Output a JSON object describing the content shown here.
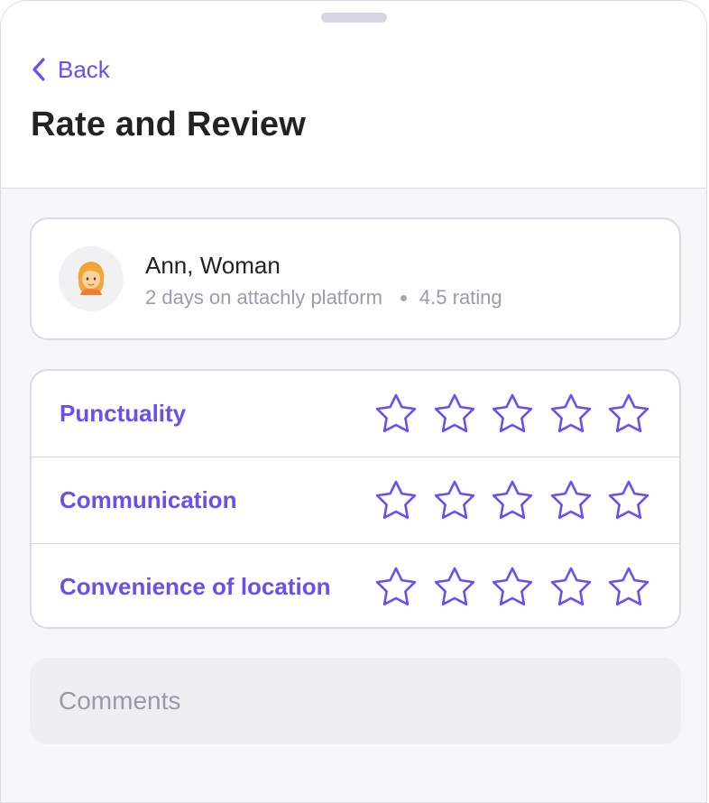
{
  "header": {
    "back_label": "Back",
    "title": "Rate and Review"
  },
  "profile": {
    "avatar_icon": "woman-emoji-icon",
    "name": "Ann, Woman",
    "platform_days": "2 days on attachly platform",
    "rating": "4.5 rating"
  },
  "ratings": [
    {
      "label": "Punctuality",
      "stars_filled": 0,
      "stars_total": 5
    },
    {
      "label": "Communication",
      "stars_filled": 0,
      "stars_total": 5
    },
    {
      "label": "Convenience of location",
      "stars_filled": 0,
      "stars_total": 5
    }
  ],
  "comments": {
    "placeholder": "Comments",
    "value": ""
  },
  "colors": {
    "accent": "#6b4ef0",
    "text": "#222222",
    "muted": "#9b9aae",
    "border": "#dbdae6"
  }
}
